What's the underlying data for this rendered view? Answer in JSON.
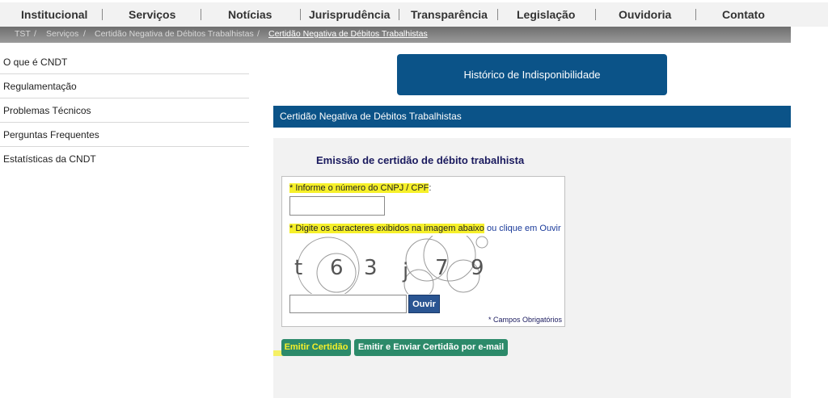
{
  "topnav": {
    "items": [
      "Institucional",
      "Serviços",
      "Notícias",
      "Jurisprudência",
      "Transparência",
      "Legislação",
      "Ouvidoria",
      "Contato"
    ]
  },
  "breadcrumb": {
    "items": [
      "TST",
      "Serviços",
      "Certidão Negativa de Débitos Trabalhistas",
      "Certidão Negativa de Débitos Trabalhistas"
    ],
    "separator": "/"
  },
  "sidebar": {
    "items": [
      "O que é CNDT",
      "Regulamentação",
      "Problemas Técnicos",
      "Perguntas Frequentes",
      "Estatísticas da CNDT"
    ]
  },
  "history_button": {
    "label": "Histórico de Indisponibilidade"
  },
  "section": {
    "title": "Certidão Negativa de Débitos Trabalhistas"
  },
  "form": {
    "title": "Emissão de certidão de débito trabalhista",
    "cnpj_label": "* Informe o número do CNPJ / CPF",
    "cnpj_colon": ":",
    "cnpj_value": "",
    "captcha_label": "* Digite os caracteres exibidos na imagem abaixo",
    "captcha_link": " ou clique em Ouvir",
    "captcha_chars": [
      "t",
      "6",
      "3",
      "j",
      "7",
      "9"
    ],
    "captcha_value": "",
    "listen_button": "Ouvir",
    "required_note": "* Campos Obrigatórios",
    "emit_button": "Emitir Certidão",
    "emit_email_button": "Emitir e Enviar Certidão por e-mail"
  },
  "colors": {
    "primary_blue": "#0b5388",
    "action_green": "#2c8a6a",
    "highlight_yellow": "#f6f02a"
  }
}
